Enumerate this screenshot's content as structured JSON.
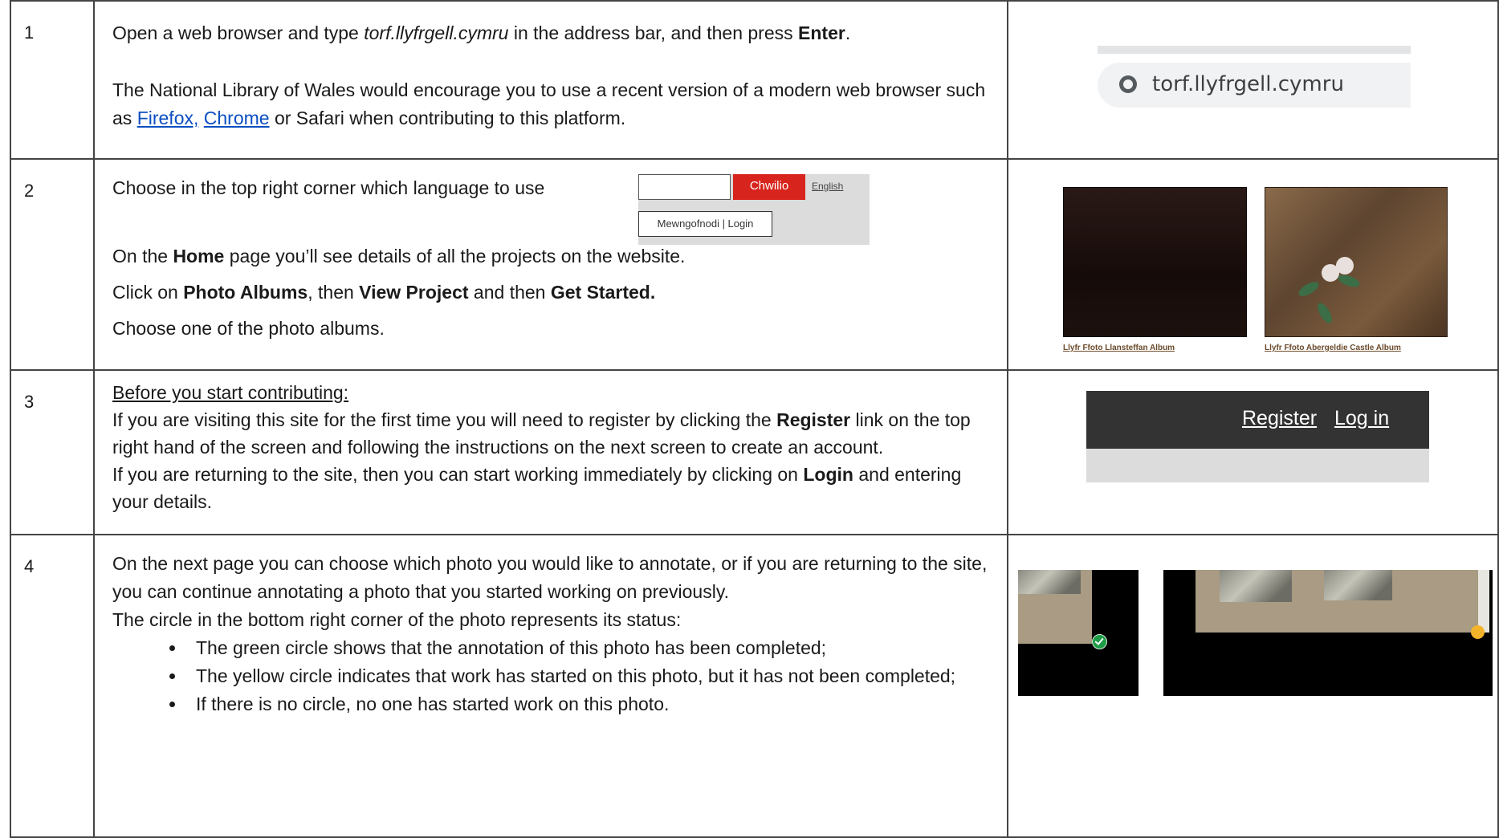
{
  "steps": [
    {
      "number": "1",
      "line1_a": "Open a web browser and type ",
      "line1_url": "torf.llyfrgell.cymru",
      "line1_b": " in the address bar, and then press ",
      "line1_key": "Enter",
      "line1_c": ".",
      "para2_a": "The National Library of Wales would encourage you to use a recent version of a modern web browser such as ",
      "link_firefox": "Firefox,",
      "link_chrome": "Chrome",
      "para2_b": " or Safari when contributing to this platform.",
      "image_address": "torf.llyfrgell.cymru"
    },
    {
      "number": "2",
      "line1": "Choose in the top right corner which language to use",
      "search_button": "Chwilio",
      "english_link": "English",
      "login_button": "Mewngofnodi | Login",
      "line2_a": "On the ",
      "line2_b": "Home",
      "line2_c": " page you’ll see details of all the projects on the website.",
      "line3_a": "Click on ",
      "line3_b": "Photo Albums",
      "line3_c": ", then ",
      "line3_d": "View Project",
      "line3_e": " and then ",
      "line3_f": "Get Started.",
      "line4": "Choose one of the photo albums.",
      "album1_caption": "Llyfr Ffoto Llansteffan Album",
      "album2_caption": "Llyfr Ffoto Abergeldie Castle Album"
    },
    {
      "number": "3",
      "heading": "Before you start contributing:",
      "p1_a": "If you are visiting this site for the first time you will need to register by clicking the ",
      "p1_b": "Register",
      "p1_c": " link on the top right hand of the screen and following the instructions on the next screen to create an account.",
      "p2_a": "If you are returning to the site, then you can start working immediately by clicking on ",
      "p2_b": "Login",
      "p2_c": " and entering your details.",
      "register_link": "Register",
      "login_link": "Log in"
    },
    {
      "number": "4",
      "p1": "On the next page you can choose which photo you would like to annotate, or if you are returning to the site, you can continue annotating a photo that you started working on previously.",
      "p2": "The circle in the bottom right corner of the photo represents its status:",
      "bullets": [
        "The green circle shows that the annotation of this photo has been completed;",
        "The yellow circle indicates that work has started on this photo, but it has not been completed;",
        "If there is no circle, no one has started work on this photo."
      ]
    }
  ],
  "colors": {
    "link": "#0b4fc1",
    "search_button": "#d7251d",
    "register_bar": "#333333",
    "status_green": "#1e9c47",
    "status_yellow": "#f3b32a"
  },
  "icons": {
    "address_bar": "globe-icon",
    "completed": "green-check-circle-icon",
    "in_progress": "yellow-circle-icon"
  }
}
